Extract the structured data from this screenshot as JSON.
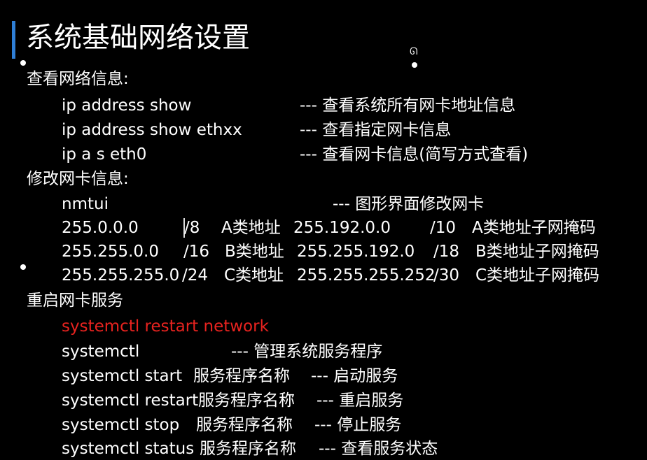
{
  "title": "系统基础网络设置",
  "colors": {
    "background": "#000000",
    "text": "#ffffff",
    "accent_bar": "#2f7fd6",
    "highlight": "#e8231f"
  },
  "sections": {
    "view": {
      "heading": "查看网络信息:",
      "rows": [
        {
          "cmd": "ip address show",
          "desc": "--- 查看系统所有网卡地址信息"
        },
        {
          "cmd": "ip address show ethxx",
          "desc": "--- 查看指定网卡信息"
        },
        {
          "cmd": "ip a s eth0",
          "desc": "--- 查看网卡信息(简写方式查看)"
        }
      ]
    },
    "modify": {
      "heading": "修改网卡信息:",
      "nmtui": {
        "cmd": "nmtui",
        "desc": "--- 图形界面修改网卡"
      },
      "masks": [
        {
          "mask": "255.0.0.0",
          "prefix": "/8",
          "cls": "A类地址",
          "sub_mask": "255.192.0.0",
          "sub_prefix": "/10",
          "sub_cls": "A类地址子网掩码"
        },
        {
          "mask": "255.255.0.0",
          "prefix": "/16",
          "cls": "B类地址",
          "sub_mask": "255.255.192.0",
          "sub_prefix": "/18",
          "sub_cls": "B类地址子网掩码"
        },
        {
          "mask": "255.255.255.0",
          "prefix": "/24",
          "cls": "C类地址",
          "sub_mask": "255.255.255.252",
          "sub_prefix": "/30",
          "sub_cls": "C类地址子网掩码"
        }
      ]
    },
    "restart": {
      "heading": "重启网卡服务",
      "highlight_cmd": "systemctl restart network",
      "systemctl": {
        "cmd": "systemctl",
        "desc": "--- 管理系统服务程序"
      },
      "ops": [
        {
          "cmd": "systemctl start",
          "arg": "服务程序名称",
          "desc": "--- 启动服务"
        },
        {
          "cmd": "systemctl restart",
          "arg": "服务程序名称",
          "desc": "--- 重启服务"
        },
        {
          "cmd": "systemctl stop",
          "arg": "服务程序名称",
          "desc": "--- 停止服务"
        },
        {
          "cmd": "systemctl status",
          "arg": "服务程序名称",
          "desc": "--- 查看服务状态"
        }
      ]
    }
  }
}
